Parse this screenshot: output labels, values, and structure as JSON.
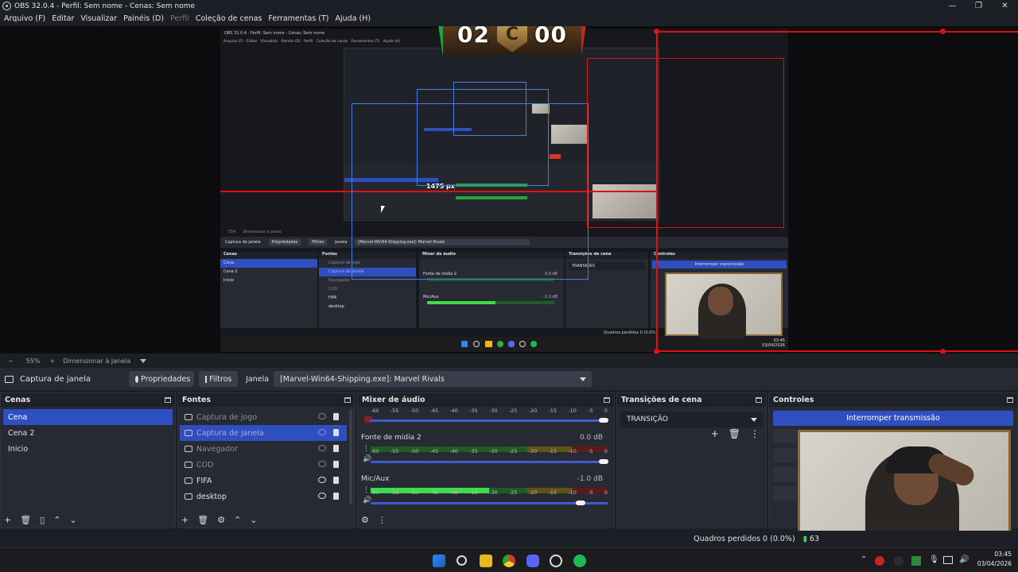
{
  "window": {
    "title": "OBS 32.0.4 - Perfil: Sem nome - Cenas: Sem nome",
    "min": "—",
    "max": "❐",
    "close": "✕"
  },
  "menu": [
    "Arquivo (F)",
    "Editar",
    "Visualizar",
    "Painéis (D)",
    "Perfil",
    "Coleção de cenas",
    "Ferramentas (T)",
    "Ajuda (H)"
  ],
  "scoreboard": {
    "left": "02",
    "right": "00",
    "logo": "C"
  },
  "preview_nested": {
    "title": "OBS 32.0.4 - Perfil: Sem nome - Cenas: Sem nome",
    "menu": "Arquivo (F)   Editar   Visualizar   Painéis (D)   Perfil   Coleção de cenas   Ferramentas (T)   Ajuda (H)",
    "px_label": "1475 px",
    "zoom_bar": "55%      Dimensionar à janela",
    "ctx": {
      "source": "Captura de janela",
      "props": "Propriedades",
      "filters": "Filtros",
      "window": "Janela",
      "value": "[Marvel-Win64-Shipping.exe]: Marvel Rivals"
    },
    "scenes_title": "Cenas",
    "scenes": [
      "Cena",
      "Cena 2",
      "Inicio"
    ],
    "sources_title": "Fontes",
    "sources": [
      "Captura de jogo",
      "Captura de janela",
      "Navegador",
      "COD",
      "FIFA",
      "desktop"
    ],
    "mixer_title": "Mixer de áudio",
    "mixer_ch1": "Fonte de mídia 2",
    "mixer_ch1_db": "0.0 dB",
    "mixer_ch2": "Mic/Aux",
    "mixer_ch2_db": "-1.0 dB",
    "transitions_title": "Transições de cena",
    "transition_value": "TRANSIÇÃO",
    "controls_title": "Controles",
    "controls_btn": "Interromper transmissão",
    "dropped": "Quadros perdidos 0 (0.0%)",
    "time": "03:45",
    "date": "03/04/2026"
  },
  "zoombar": {
    "minus": "−",
    "zoom": "55%",
    "plus": "+",
    "fit": "Dimensionar à janela"
  },
  "context": {
    "source": "Captura de janela",
    "properties": "Propriedades",
    "filters": "Filtros",
    "window_label": "Janela",
    "window_value": "[Marvel-Win64-Shipping.exe]: Marvel Rivals"
  },
  "scenes": {
    "title": "Cenas",
    "items": [
      "Cena",
      "Cena 2",
      "Inicio"
    ],
    "selected": 0
  },
  "sources": {
    "title": "Fontes",
    "items": [
      {
        "name": "Captura de jogo",
        "visible": false,
        "locked": true
      },
      {
        "name": "Captura de janela",
        "visible": false,
        "locked": true
      },
      {
        "name": "Navegador",
        "visible": false,
        "locked": true
      },
      {
        "name": "COD",
        "visible": false,
        "locked": true
      },
      {
        "name": "FIFA",
        "visible": true,
        "locked": true
      },
      {
        "name": "desktop",
        "visible": true,
        "locked": true
      }
    ],
    "selected": 1
  },
  "mixer": {
    "title": "Mixer de áudio",
    "scale": [
      "-60",
      "-55",
      "-50",
      "-45",
      "-40",
      "-35",
      "-30",
      "-25",
      "-20",
      "-15",
      "-10",
      "-5",
      "0"
    ],
    "channels": [
      {
        "name": "",
        "db": "",
        "level": 0.0,
        "volume": 0.98
      },
      {
        "name": "Fonte de mídia 2",
        "db": "0.0 dB",
        "level": 0.0,
        "volume": 0.98
      },
      {
        "name": "Mic/Aux",
        "db": "-1.0 dB",
        "level": 0.5,
        "volume": 0.88
      }
    ]
  },
  "transitions": {
    "title": "Transições de cena",
    "value": "TRANSIÇÃO"
  },
  "controls": {
    "title": "Controles",
    "stop_stream": "Interromper transmissão"
  },
  "status": {
    "dropped": "Quadros perdidos 0 (0.0%)",
    "fps": "63"
  },
  "taskbar": {
    "time": "03:45",
    "date": "03/04/2026"
  },
  "colors": {
    "accent": "#2f4fc1",
    "bg": "#1d1f26",
    "panel": "#272a33",
    "guide": "#dd1111",
    "bbox": "#4a7be0"
  }
}
